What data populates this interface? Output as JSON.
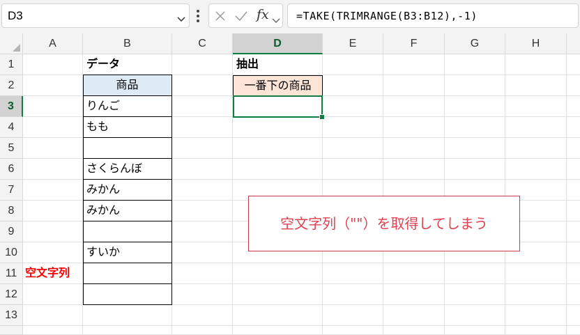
{
  "formula_bar": {
    "name_box": "D3",
    "fx_icon": "fx",
    "formula": "=TAKE(TRIMRANGE(B3:B12),-1)"
  },
  "columns": [
    "A",
    "B",
    "C",
    "D",
    "E",
    "F",
    "G",
    "H"
  ],
  "selected_column": "D",
  "rows": [
    "1",
    "2",
    "3",
    "4",
    "5",
    "6",
    "7",
    "8",
    "9",
    "10",
    "11",
    "12",
    "13"
  ],
  "selected_row": "3",
  "cells": {
    "B1": "データ",
    "B2": "商品",
    "B3": "りんご",
    "B4": "もも",
    "B5": "",
    "B6": "さくらんぼ",
    "B7": "みかん",
    "B8": "みかん",
    "B9": "",
    "B10": "すいか",
    "B11": "",
    "B12": "",
    "D1": "抽出",
    "D2": "一番下の商品",
    "D3": "",
    "A11": "空文字列"
  },
  "callout": {
    "text": "空文字列（\"\"）を取得してしまう"
  },
  "colors": {
    "header_fill_B2": "#ddebf7",
    "header_fill_D2": "#fce4d6",
    "selection_green": "#107c41",
    "red_text": "#ff0000",
    "callout_text": "#e0404f",
    "callout_border": "#c5394a"
  }
}
